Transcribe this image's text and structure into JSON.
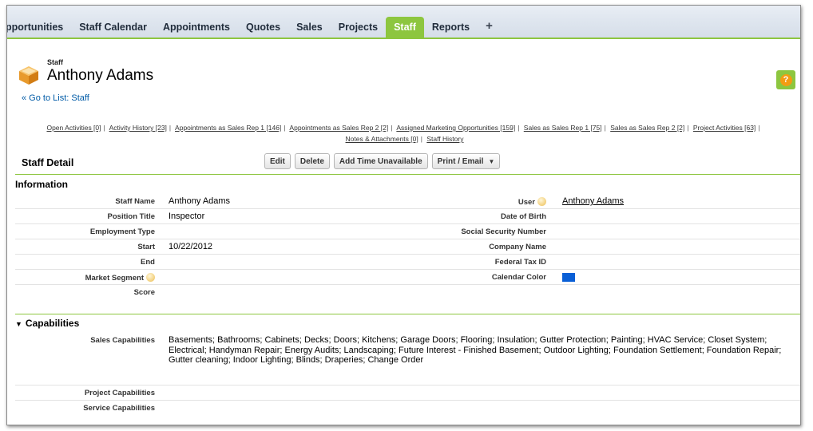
{
  "tabs": [
    {
      "label": "pportunities"
    },
    {
      "label": "Staff Calendar"
    },
    {
      "label": "Appointments"
    },
    {
      "label": "Quotes"
    },
    {
      "label": "Sales"
    },
    {
      "label": "Projects"
    },
    {
      "label": "Staff"
    },
    {
      "label": "Reports"
    },
    {
      "label": "+"
    }
  ],
  "header": {
    "object_label": "Staff",
    "title": "Anthony Adams",
    "back_link": "« Go to List: Staff"
  },
  "related_links": [
    "Open Activities [0]",
    "Activity History [23]",
    "Appointments as Sales Rep 1 [146]",
    "Appointments as Sales Rep 2 [2]",
    "Assigned Marketing Opportunities [159]",
    "Sales as Sales Rep 1 [75]",
    "Sales as Sales Rep 2 [2]",
    "Project Activities [63]",
    "Notes & Attachments [0]",
    "Staff History"
  ],
  "detail": {
    "title": "Staff Detail",
    "buttons": {
      "edit": "Edit",
      "delete": "Delete",
      "add_time": "Add Time Unavailable",
      "print": "Print / Email"
    }
  },
  "information": {
    "title": "Information",
    "left": [
      {
        "label": "Staff Name",
        "value": "Anthony Adams"
      },
      {
        "label": "Position Title",
        "value": "Inspector"
      },
      {
        "label": "Employment Type",
        "value": ""
      },
      {
        "label": "Start",
        "value": "10/22/2012"
      },
      {
        "label": "End",
        "value": ""
      },
      {
        "label": "Market Segment",
        "value": ""
      },
      {
        "label": "Score",
        "value": ""
      }
    ],
    "right": [
      {
        "label": "User",
        "value": "Anthony Adams"
      },
      {
        "label": "Date of Birth",
        "value": ""
      },
      {
        "label": "Social Security Number",
        "value": ""
      },
      {
        "label": "Company Name",
        "value": ""
      },
      {
        "label": "Federal Tax ID",
        "value": ""
      },
      {
        "label": "Calendar Color",
        "value": ""
      }
    ],
    "calendar_color": "#0a5fd6"
  },
  "capabilities": {
    "title": "Capabilities",
    "sales_label": "Sales Capabilities",
    "sales_value": "Basements; Bathrooms; Cabinets; Decks; Doors; Kitchens; Garage Doors; Flooring; Insulation; Gutter Protection; Painting; HVAC Service; Closet System; Electrical; Handyman Repair; Energy Audits; Landscaping; Future Interest - Finished Basement; Outdoor Lighting; Foundation Settlement; Foundation Repair; Gutter cleaning; Indoor Lighting; Blinds; Draperies; Change Order",
    "project_label": "Project Capabilities",
    "service_label": "Service Capabilities"
  },
  "colors": {
    "accent_green": "#8dc63f",
    "link_blue": "#015ba7",
    "help_orange": "#f39c12"
  }
}
